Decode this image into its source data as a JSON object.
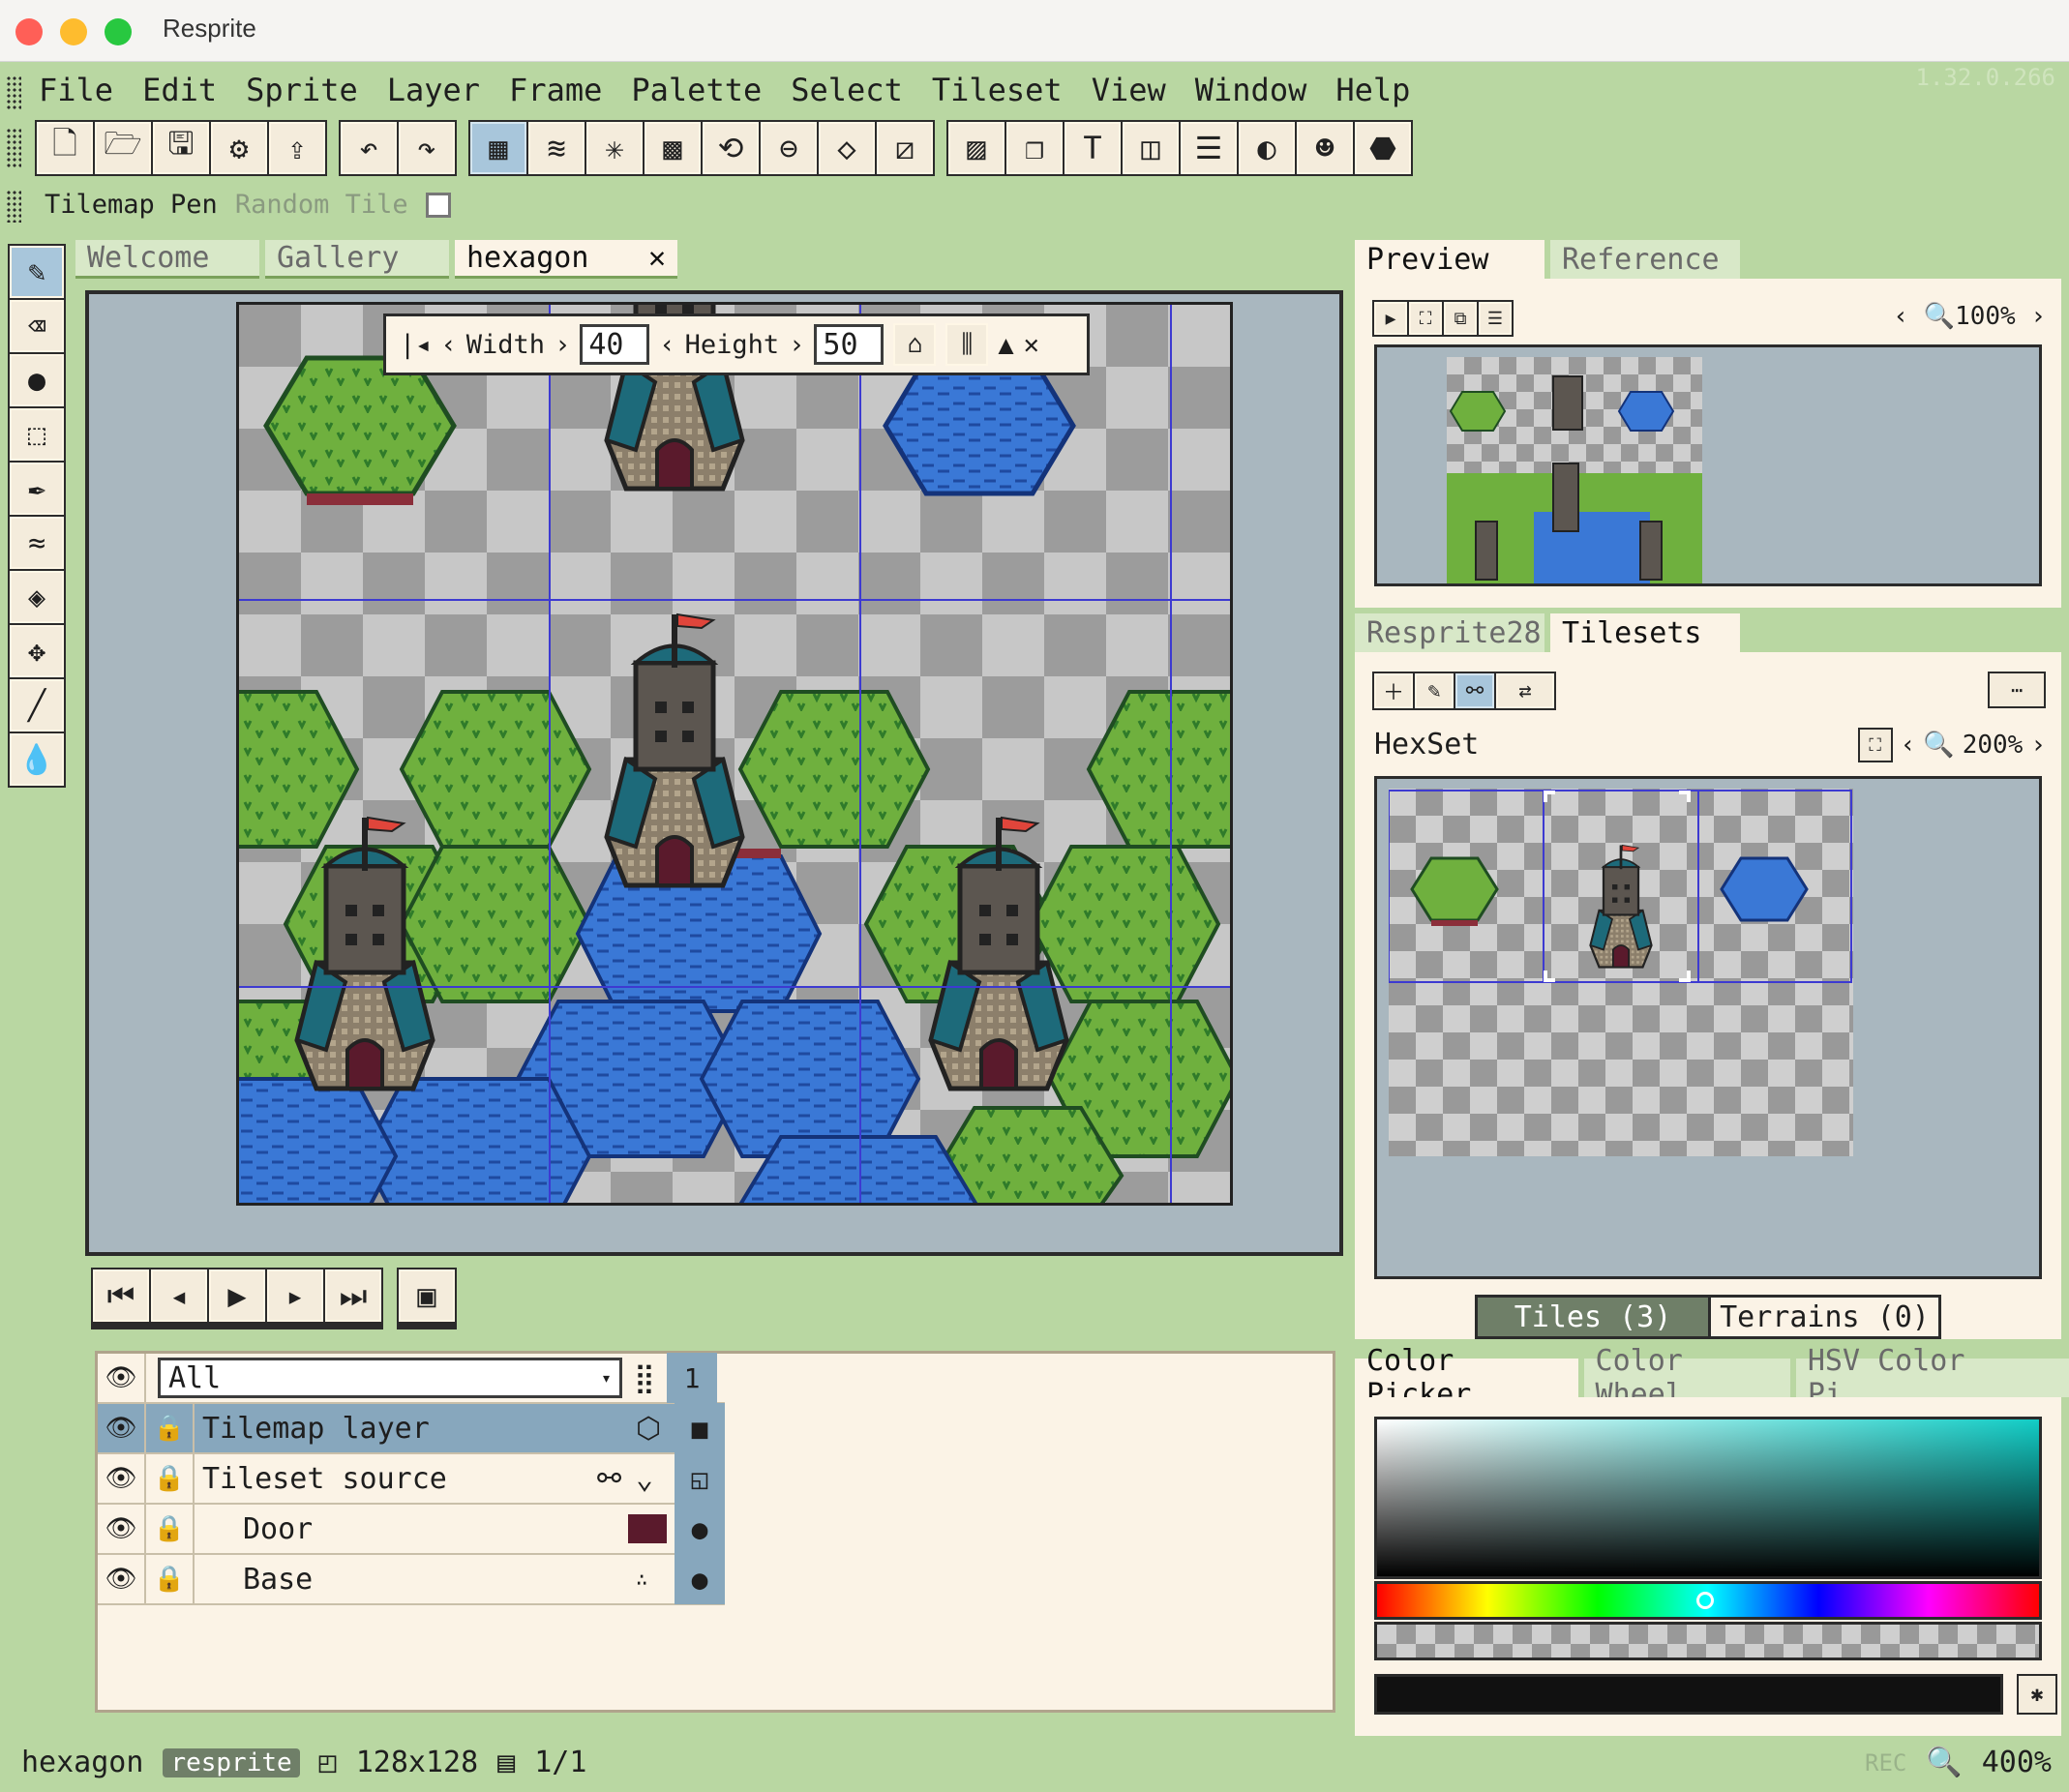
{
  "window": {
    "title": "Resprite",
    "version": "1.32.0.266"
  },
  "menu": [
    "File",
    "Edit",
    "Sprite",
    "Layer",
    "Frame",
    "Palette",
    "Select",
    "Tileset",
    "View",
    "Window",
    "Help"
  ],
  "context": {
    "tool": "Tilemap Pen",
    "random_label": "Random Tile"
  },
  "tabs": [
    "Welcome",
    "Gallery",
    "hexagon"
  ],
  "canvas_controls": {
    "width_label": "Width",
    "width_value": "40",
    "height_label": "Height",
    "height_value": "50"
  },
  "layers": {
    "filter": "All",
    "frame_number": "1",
    "rows": [
      {
        "name": "Tilemap layer",
        "selected": true
      },
      {
        "name": "Tileset source",
        "selected": false
      },
      {
        "name": "Door",
        "selected": false
      },
      {
        "name": "Base",
        "selected": false
      }
    ]
  },
  "preview": {
    "tabs": [
      "Preview",
      "Reference"
    ],
    "zoom": "100%"
  },
  "tilesets": {
    "tabs": [
      "Resprite28",
      "Tilesets"
    ],
    "name": "HexSet",
    "zoom": "200%",
    "tiles_tab": "Tiles (3)",
    "terrains_tab": "Terrains (0)"
  },
  "color": {
    "tabs": [
      "Color Picker",
      "Color Wheel",
      "HSV Color Pi..."
    ]
  },
  "status": {
    "file": "hexagon",
    "badge": "resprite",
    "size": "128x128",
    "frames": "1/1",
    "rec": "REC",
    "zoom": "400%"
  }
}
